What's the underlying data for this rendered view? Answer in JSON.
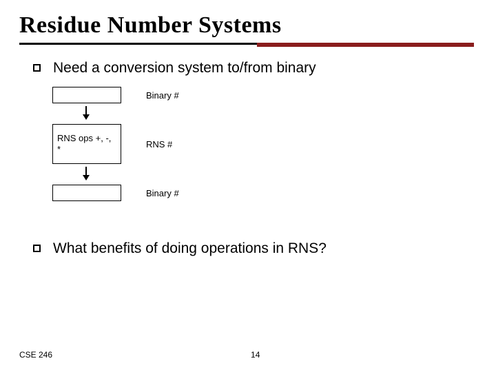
{
  "title": "Residue Number Systems",
  "bullets": {
    "b1": "Need a conversion system to/from binary",
    "b2": "What benefits of doing operations in RNS?"
  },
  "diagram": {
    "label_top": "Binary #",
    "box_ops": "RNS ops +, -, *",
    "label_mid": "RNS #",
    "label_bot": "Binary #"
  },
  "footer": {
    "course": "CSE 246",
    "page": "14"
  }
}
